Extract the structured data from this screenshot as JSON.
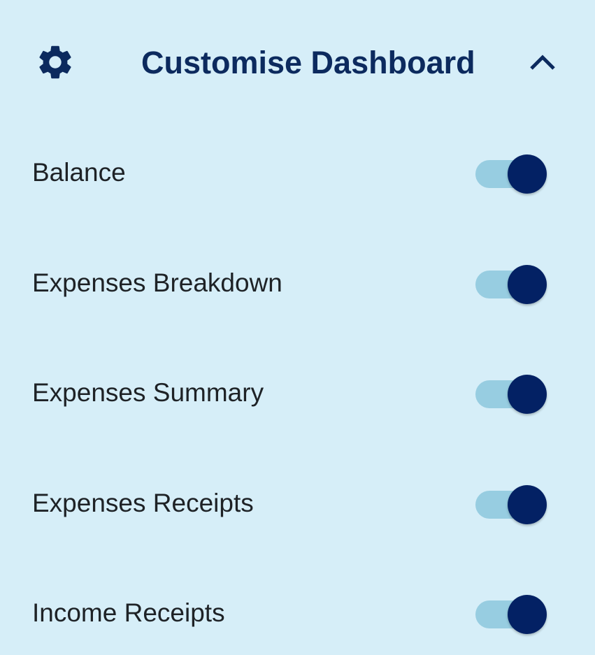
{
  "header": {
    "title": "Customise Dashboard",
    "settings_icon": "gear-icon",
    "collapse_icon": "chevron-up-icon",
    "expanded": true
  },
  "colors": {
    "background": "#d6eef8",
    "title": "#0c2a5e",
    "text": "#1e2226",
    "switch_track_on": "#97cde1",
    "switch_thumb_on": "#032164"
  },
  "items": [
    {
      "label": "Balance",
      "enabled": true
    },
    {
      "label": "Expenses Breakdown",
      "enabled": true
    },
    {
      "label": "Expenses Summary",
      "enabled": true
    },
    {
      "label": "Expenses Receipts",
      "enabled": true
    },
    {
      "label": "Income Receipts",
      "enabled": true
    }
  ]
}
